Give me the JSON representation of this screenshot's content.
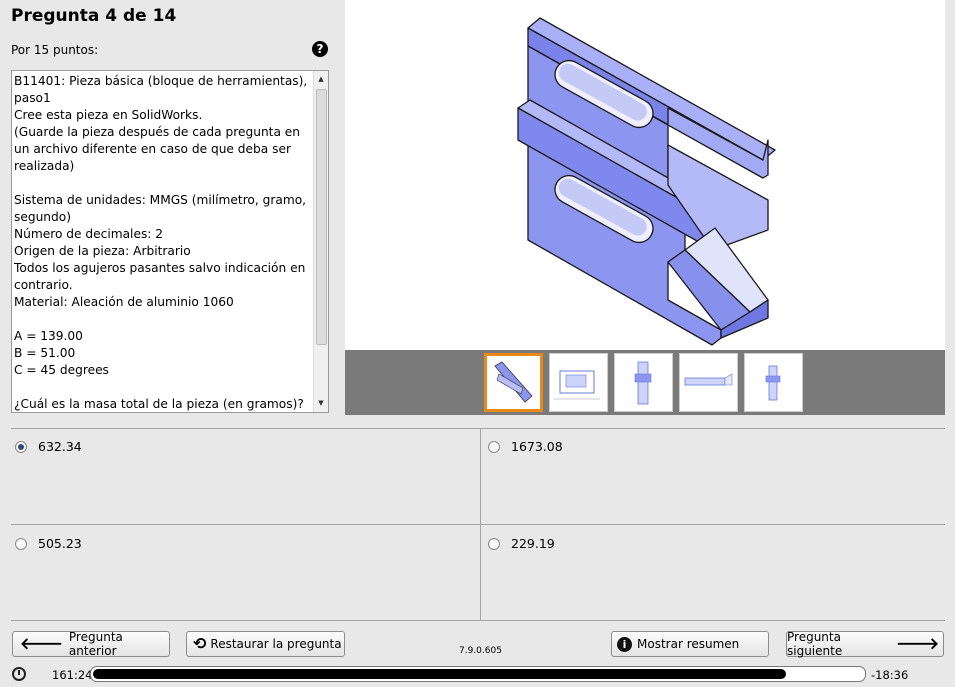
{
  "header": {
    "title": "Pregunta 4 de 14",
    "points": "Por 15 puntos:",
    "help_icon": "?"
  },
  "question": {
    "text": "B11401: Pieza básica (bloque de herramientas),\npaso1\nCree esta pieza en SolidWorks.\n(Guarde la pieza después de cada pregunta en un archivo diferente en caso de que deba ser realizada)\n\nSistema de unidades: MMGS (milímetro, gramo, segundo)\nNúmero de decimales: 2\nOrigen de la pieza: Arbitrario\nTodos los agujeros pasantes salvo indicación en contrario.\nMaterial: Aleación de aluminio 1060\n\nA = 139.00\nB = 51.00\nC = 45 degrees\n\n¿Cuál es la masa total de la pieza (en gramos)?"
  },
  "answers": [
    {
      "label": "632.34",
      "selected": true
    },
    {
      "label": "1673.08",
      "selected": false
    },
    {
      "label": "505.23",
      "selected": false
    },
    {
      "label": "229.19",
      "selected": false
    }
  ],
  "buttons": {
    "prev": "Pregunta anterior",
    "restore": "Restaurar la pregunta",
    "summary": "Mostrar resumen",
    "next": "Pregunta siguiente"
  },
  "version": "7.9.0.605",
  "timer": {
    "elapsed": "161:24",
    "remaining": "-18:36",
    "progress_fraction": 0.9
  },
  "colors": {
    "part_blue": "#8c95f0",
    "thumb_selected": "#e88a1a"
  }
}
